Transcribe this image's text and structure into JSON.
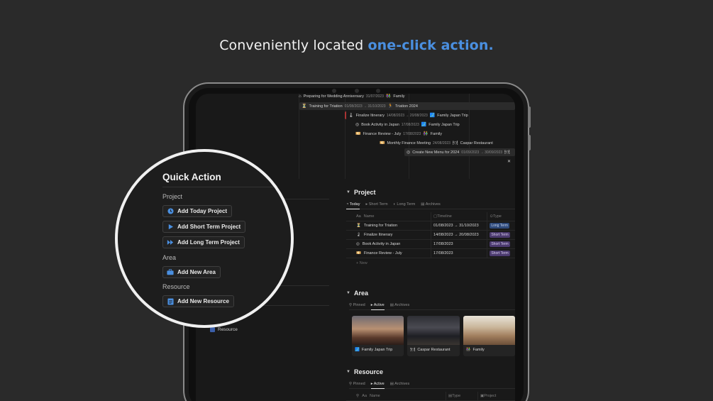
{
  "headline": {
    "prefix": "Conveniently located ",
    "accent": "one-click action."
  },
  "gantt": [
    {
      "icon": "⌂",
      "title": "Preparing for Wedding Anniversary",
      "date": "31/07/2023",
      "tag_icon": "👫",
      "tag": "Family"
    },
    {
      "icon": "⏳",
      "title": "Training for Triation",
      "date": "01/08/2023 → 31/10/2023",
      "tag_icon": "🏃",
      "tag": "Triation 2024"
    },
    {
      "icon": "🌡",
      "title": "Finalize Itinerary",
      "date": "14/08/2023 → 20/08/2023",
      "tag_icon": "🗾",
      "tag": "Family Japan Trip"
    },
    {
      "icon": "◎",
      "title": "Book Activity in Japan",
      "date": "17/08/2023",
      "tag_icon": "🗾",
      "tag": "Family Japan Trip"
    },
    {
      "icon": "💴",
      "title": "Finance Review - July",
      "date": "17/08/2023",
      "tag_icon": "👫",
      "tag": "Family"
    },
    {
      "icon": "💴",
      "title": "Monthly Finance Meeting",
      "date": "24/08/2023",
      "tag_icon": "🍽",
      "tag": "Caspar Restaurant"
    },
    {
      "icon": "◎",
      "title": "Create New Menu for 2024",
      "date": "01/09/2023 → 30/09/2023",
      "tag_icon": "🍽",
      "tag": ""
    },
    {
      "icon": "✕",
      "title": "",
      "date": "",
      "tag_icon": "",
      "tag": ""
    }
  ],
  "left": {
    "resource_label": "Resource"
  },
  "project": {
    "title": "Project",
    "tabs": [
      "Today",
      "Short Term",
      "Long Term",
      "Archives"
    ],
    "active_tab": "Today",
    "headers": [
      "Name",
      "Timeline",
      "Type"
    ],
    "rows": [
      {
        "icon": "⏳",
        "name": "Training for Triation",
        "timeline": "01/08/2023 → 31/10/2023",
        "type": "Long Term"
      },
      {
        "icon": "🌡",
        "name": "Finalize Itinerary",
        "timeline": "14/08/2023 → 20/08/2023",
        "type": "Short Term"
      },
      {
        "icon": "◎",
        "name": "Book Activity in Japan",
        "timeline": "17/08/2023",
        "type": "Short Term"
      },
      {
        "icon": "💴",
        "name": "Finance Review - July",
        "timeline": "17/08/2023",
        "type": "Short Term"
      }
    ],
    "new_label": "+ New"
  },
  "area": {
    "title": "Area",
    "tabs": [
      "Pinned",
      "Active",
      "Archives"
    ],
    "cards": [
      {
        "icon": "🗾",
        "label": "Family Japan Trip"
      },
      {
        "icon": "🍽",
        "label": "Caspar Restaurant"
      },
      {
        "icon": "👫",
        "label": "Family"
      }
    ]
  },
  "resource": {
    "title": "Resource",
    "tabs": [
      "Pinned",
      "Active",
      "Archives"
    ],
    "headers": [
      "Name",
      "Type",
      "Project"
    ]
  },
  "quick_action": {
    "title": "Quick Action",
    "groups": [
      {
        "label": "Project",
        "buttons": [
          "Add Today Project",
          "Add Short Term Project",
          "Add Long Term Project"
        ]
      },
      {
        "label": "Area",
        "buttons": [
          "Add New Area"
        ]
      },
      {
        "label": "Resource",
        "buttons": [
          "Add New Resource"
        ]
      }
    ]
  }
}
